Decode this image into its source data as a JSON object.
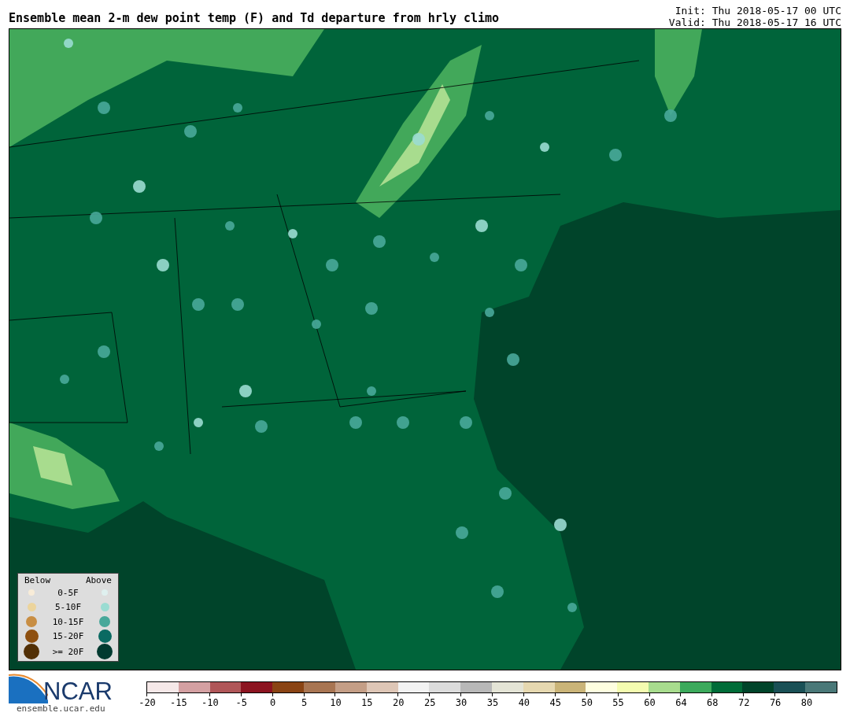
{
  "title": "Ensemble mean 2-m dew point temp (F) and Td departure from hrly climo",
  "init": "Init: Thu 2018-05-17 00 UTC",
  "valid": "Valid: Thu 2018-05-17 16 UTC",
  "legend": {
    "below_label": "Below",
    "above_label": "Above",
    "rows": [
      {
        "label": "0-5F",
        "below": {
          "color": "#f8ecd8"
        },
        "above": {
          "color": "#dff0ef"
        }
      },
      {
        "label": "5-10F",
        "below": {
          "color": "#ecd49c"
        },
        "above": {
          "color": "#9adcd2"
        }
      },
      {
        "label": "10-15F",
        "below": {
          "color": "#c88e44"
        },
        "above": {
          "color": "#48a89a"
        }
      },
      {
        "label": "15-20F",
        "below": {
          "color": "#8e5010"
        },
        "above": {
          "color": "#0a6a62"
        }
      },
      {
        "label": ">= 20F",
        "below": {
          "color": "#523006"
        },
        "above": {
          "color": "#013a30"
        }
      }
    ]
  },
  "logo": {
    "text": "NCAR",
    "url": "ensemble.ucar.edu"
  },
  "colorbar": {
    "segments": [
      {
        "color": "#f5e8e8"
      },
      {
        "color": "#d4a0a2"
      },
      {
        "color": "#b05658"
      },
      {
        "color": "#8c1420"
      },
      {
        "color": "#8a4414"
      },
      {
        "color": "#a87552"
      },
      {
        "color": "#c49e86"
      },
      {
        "color": "#dec6b6"
      },
      {
        "color": "#f2f2f2"
      },
      {
        "color": "#dcdcdc"
      },
      {
        "color": "#b8b8b8"
      },
      {
        "color": "#e4e4d6"
      },
      {
        "color": "#e6d8b0"
      },
      {
        "color": "#cab478"
      },
      {
        "color": "#fefee0"
      },
      {
        "color": "#f4fcb0"
      },
      {
        "color": "#a8dc8e"
      },
      {
        "color": "#3caa5c"
      },
      {
        "color": "#006c38"
      },
      {
        "color": "#00442a"
      },
      {
        "color": "#1a5056"
      },
      {
        "color": "#4a7878"
      }
    ],
    "ticks": [
      "-20",
      "-15",
      "-10",
      "-5",
      "0",
      "5",
      "10",
      "15",
      "20",
      "25",
      "30",
      "35",
      "40",
      "45",
      "50",
      "55",
      "60",
      "64",
      "68",
      "72",
      "76",
      "80"
    ]
  }
}
